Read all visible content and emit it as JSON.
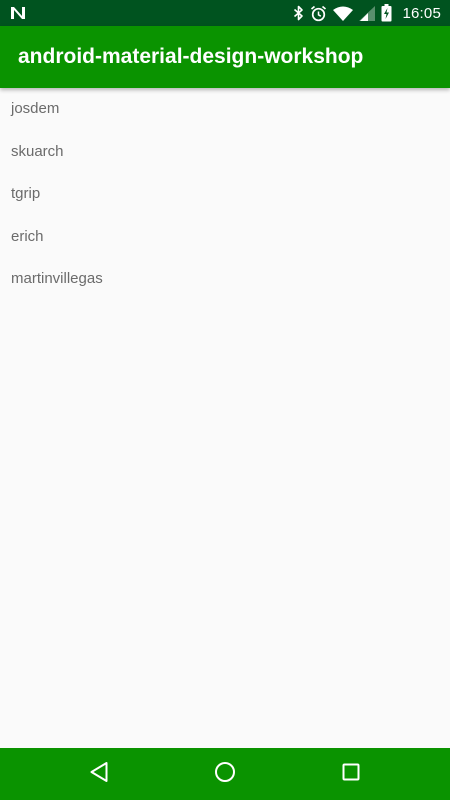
{
  "status_bar": {
    "time": "16:05",
    "icons": [
      "n-notification-icon",
      "bluetooth-icon",
      "alarm-icon",
      "wifi-icon",
      "cell-signal-icon",
      "battery-charging-icon"
    ],
    "background_color": "#00531f"
  },
  "app_bar": {
    "title": "android-material-design-workshop",
    "background_color": "#0a9300"
  },
  "list": {
    "items": [
      {
        "label": "josdem"
      },
      {
        "label": "skuarch"
      },
      {
        "label": "tgrip"
      },
      {
        "label": "erich"
      },
      {
        "label": "martinvillegas"
      }
    ]
  },
  "nav_bar": {
    "buttons": [
      "back-icon",
      "home-icon",
      "recents-icon"
    ],
    "background_color": "#0a9300"
  }
}
